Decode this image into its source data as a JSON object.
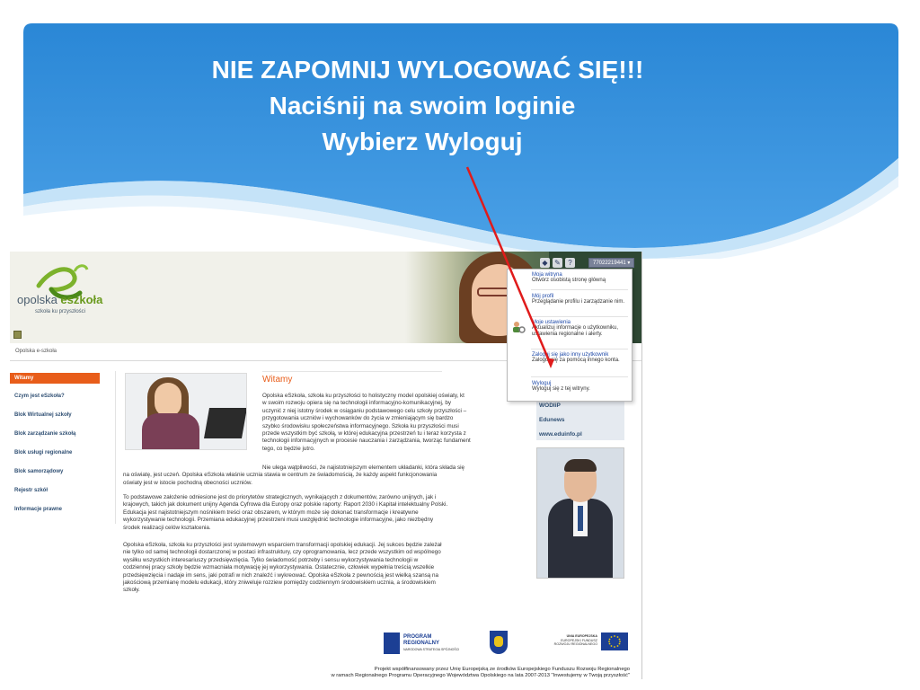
{
  "slide": {
    "headline_line1": "NIE ZAPOMNIJ WYLOGOWAĆ SIĘ!!!",
    "headline_line2": "Naciśnij na swoim loginie",
    "headline_line3": "Wybierz Wyloguj",
    "banner_color": "#2f8ad8",
    "pointer_color": "#e01b1b"
  },
  "site": {
    "logo_word1": "opolska ",
    "logo_word2": "eszkoła",
    "logo_tagline": "szkoła ku przyszłości",
    "breadcrumb": "Opolska e-szkoła",
    "user_login": "77022219441 ▾",
    "help_icon_glyph": "?",
    "accent_color": "#e85d1a",
    "link_color": "#2f4f73"
  },
  "nav": {
    "items": [
      "Witamy",
      "Czym jest eSzkoła?",
      "Blok Wirtualnej szkoły",
      "Blok zarządzanie szkołą",
      "Blok usługi regionalne",
      "Blok samorządowy",
      "Rejestr szkół",
      "Informacje prawne"
    ]
  },
  "dropdown": {
    "items": [
      {
        "title": "Moja witryna",
        "desc": "Otwórz osobistą stronę główną"
      },
      {
        "title": "Mój profil",
        "desc": "Przeglądanie profilu i zarządzanie nim."
      },
      {
        "title": "Moje ustawienia",
        "desc": "Aktualizuj informacje o użytkowniku, ustawienia regionalne i alerty."
      },
      {
        "title": "Zaloguj się jako inny użytkownik",
        "desc": "Zaloguj się za pomocą innego konta."
      },
      {
        "title": "Wyloguj",
        "desc": "Wyloguj się z tej witryny."
      }
    ]
  },
  "main": {
    "title": "Witamy",
    "p1_lines": [
      "Opolska eSzkoła, szkoła ku przyszłości to holistyczny model opolskiej oświaty, kt",
      "w swoim rozwoju opiera się na technologii informacyjno-komunikacyjnej, by",
      "uczynić z niej istotny środek w osiąganiu podstawowego celu szkoły przyszłości –",
      "przygotowania uczniów i wychowanków do życia w zmieniającym się bardzo",
      "szybko środowisku społeczeństwa informacyjnego. Szkoła ku przyszłości musi",
      "przede wszystkim być szkołą, w której edukacyjna przestrzeń tu i teraz korzysta z",
      "technologii informacyjnych w procesie nauczania i zarządzania, tworząc fundament",
      "tego, co będzie jutro."
    ],
    "p2_lines": [
      "Nie ulega wątpliwości, że najistotniejszym elementem układanki, która składa się",
      "na oświatę, jest uczeń. Opolska eSzkoła właśnie ucznia stawia w centrum ze świadomością, że każdy aspekt funkcjonowania",
      "oświaty jest w istocie pochodną obecności uczniów."
    ],
    "p3_lines": [
      "To podstawowe założenie odniesione jest do priorytetów strategicznych, wynikających z dokumentów, zarówno unijnych, jak i",
      "krajowych, takich jak dokument unijny Agenda Cyfrowa dla Europy oraz polskie raporty: Raport 2030 i Kapitał intelektualny Polski.",
      "Edukacja jest najistotniejszym nośnikiem treści oraz obszarem, w którym może się dokonać transformacje i kreatywne",
      "wykorzystywanie technologii. Przemiana edukacyjnej przestrzeni musi uwzględnić technologie informacyjne, jako niezbędny",
      "środek realizacji celów kształcenia."
    ],
    "p4_lines": [
      "Opolska eSzkoła, szkoła ku przyszłości jest systemowym wsparciem transformacji opolskiej edukacji. Jej sukces będzie zależał",
      "nie tylko od samej technologii dostarczonej w postaci infrastruktury, czy oprogramowania, lecz przede wszystkim od wspólnego",
      "wysiłku wszystkich interesariuszy przedsięwzięcia. Tylko świadomość potrzeby i sensu wykorzystywania technologii w",
      "codziennej pracy szkoły będzie wzmacniała motywację jej wykorzystywania. Ostatecznie, człowiek wypełnia treścią wszelkie",
      "przedsięwzięcia i nadaje im sens, jaki potrafi w nich znaleźć i wykreować. Opolska eSzkoła z pewnością jest wielką szansą na",
      "jakościową przemianę modelu edukacji, który zniweluje rozziew pomiędzy codziennym środowiskiem ucznia, a środowiskiem",
      "szkoły."
    ]
  },
  "right": {
    "links": [
      "WODIiP",
      "Edunews",
      "www.eduinfo.pl"
    ]
  },
  "footer": {
    "program_line1": "PROGRAM",
    "program_line2": "REGIONALNY",
    "program_sub": "NARODOWA STRATEGIA SPÓJNOŚCI",
    "eu_line1": "UNIA EUROPEJSKA",
    "eu_line2": "EUROPEJSKI FUNDUSZ",
    "eu_line3": "ROZWOJU REGIONALNEGO",
    "line1": "Projekt współfinansowany przez Unię Europejską ze środków Europejskiego Funduszu Rozwoju Regionalnego",
    "line2": "w ramach Regionalnego Programu Operacyjnego Województwa Opolskiego na lata 2007-2013 \"Inwestujemy w Twoją przyszłość\""
  }
}
